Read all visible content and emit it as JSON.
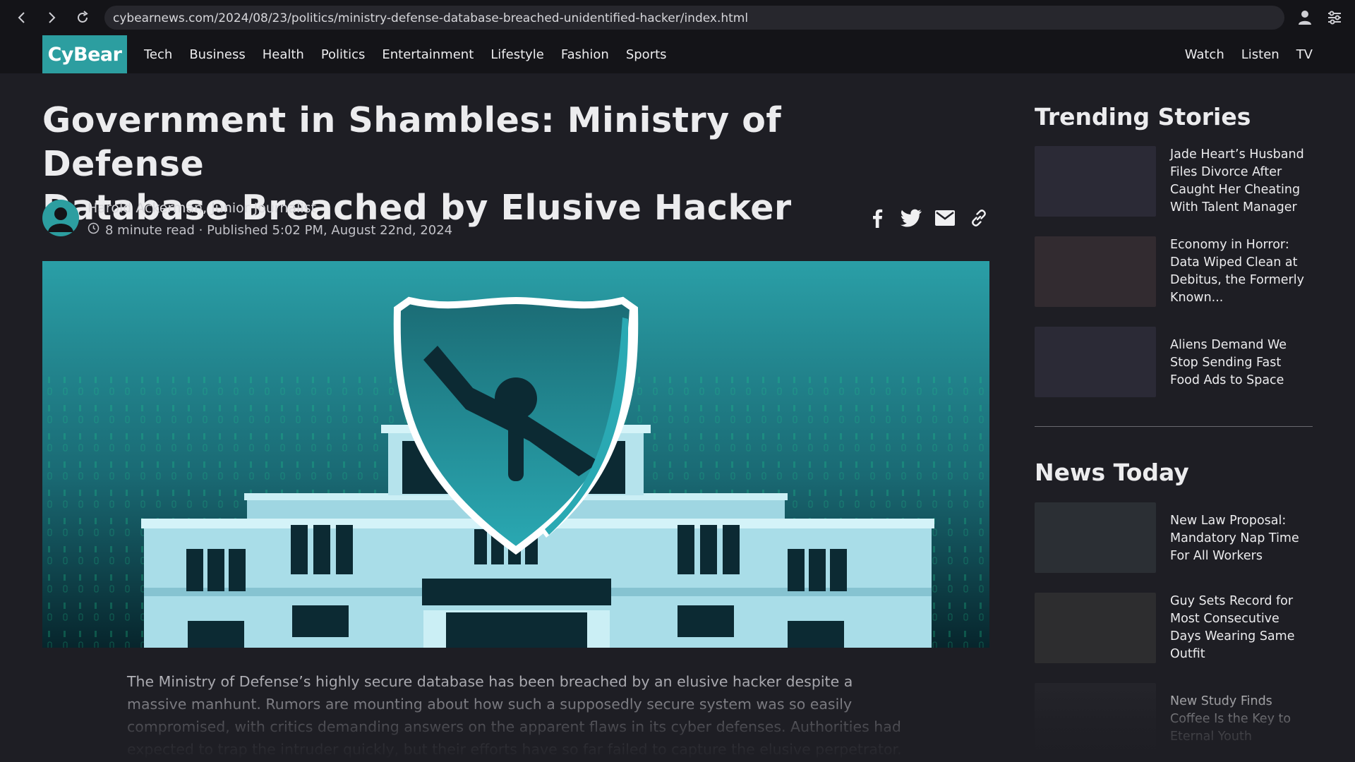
{
  "browser": {
    "url": "cybearnews.com/2024/08/23/politics/ministry-defense-database-breached-unidentified-hacker/index.html",
    "icons": [
      "back-arrow-icon",
      "forward-arrow-icon",
      "reload-icon",
      "profile-icon",
      "settings-sliders-icon"
    ]
  },
  "site": {
    "logo": "CyBear",
    "nav_main": [
      "Tech",
      "Business",
      "Health",
      "Politics",
      "Entertainment",
      "Lifestyle",
      "Fashion",
      "Sports"
    ],
    "nav_right": [
      "Watch",
      "Listen",
      "TV"
    ],
    "accent_color": "#2c9ea0"
  },
  "article": {
    "title_line1": "Government in Shambles: Ministry of Defense",
    "title_line2": "Database Breached by Elusive Hacker",
    "author": "Harold Ackerman, Junior Journalist",
    "meta": "8 minute read · Published 5:02 PM, August 22nd, 2024",
    "share_icons": [
      "facebook-icon",
      "twitter-icon",
      "email-icon",
      "link-icon"
    ],
    "body": "The Ministry of Defense’s highly secure database has been breached by an elusive hacker despite a massive manhunt. Rumors are mounting about how such a supposedly secure system was so easily compromised, with critics demanding answers on the apparent flaws in its cyber defenses. Authorities had expected to trap the intruder quickly, but their efforts have so far failed to capture the elusive perpetrator. As the hunt"
  },
  "sidebar": {
    "trending_heading": "Trending Stories",
    "trending": [
      {
        "title": "Jade Heart’s Husband Files Divorce After Caught Her Cheating With Talent Manager",
        "thumb_color": "#2b2a36"
      },
      {
        "title": "Economy in Horror: Data Wiped Clean at Debitus, the Formerly Known...",
        "thumb_color": "#322b30"
      },
      {
        "title": "Aliens Demand We Stop Sending Fast Food Ads to Space",
        "thumb_color": "#2b2a36"
      }
    ],
    "news_heading": "News Today",
    "news": [
      {
        "title": "New Law Proposal: Mandatory Nap Time For All Workers",
        "thumb_color": "#2b2f34"
      },
      {
        "title": "Guy Sets Record for Most Consecutive Days Wearing Same Outfit",
        "thumb_color": "#2d2d2f"
      },
      {
        "title": "New Study Finds Coffee Is the Key to Eternal Youth",
        "thumb_color": "#25252b"
      }
    ]
  }
}
